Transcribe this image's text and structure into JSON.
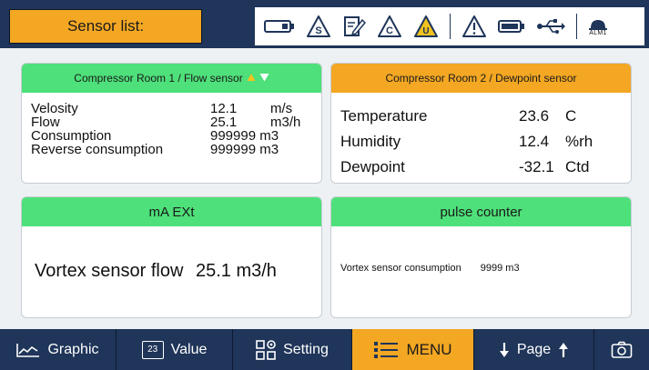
{
  "header": {
    "title": "Sensor list:",
    "status_icons": [
      "battery-icon",
      "service-s-icon",
      "edit-document-icon",
      "calibration-c-icon",
      "warning-u-icon",
      "warning-icon",
      "battery-full-icon",
      "usb-icon",
      "alarm-icon"
    ],
    "alarm_label": "ALM1"
  },
  "cards": {
    "flow": {
      "title": "Compressor Room 1 / Flow sensor",
      "rows": [
        {
          "label": "Velosity",
          "value": "12.1",
          "unit": "m/s"
        },
        {
          "label": "Flow",
          "value": "25.1",
          "unit": "m3/h"
        },
        {
          "label": "Consumption",
          "value": "999999 m3",
          "unit": ""
        },
        {
          "label": "Reverse consumption",
          "value": "999999 m3",
          "unit": ""
        }
      ]
    },
    "dewpoint": {
      "title": "Compressor Room 2 / Dewpoint sensor",
      "rows": [
        {
          "label": "Temperature",
          "value": "23.6",
          "unit": "C"
        },
        {
          "label": "Humidity",
          "value": "12.4",
          "unit": "%rh"
        },
        {
          "label": "Dewpoint",
          "value": "-32.1",
          "unit": "Ctd"
        }
      ]
    },
    "ma_ext": {
      "title": "mA EXt",
      "label": "Vortex sensor flow",
      "value": "25.1 m3/h"
    },
    "pulse": {
      "title": "pulse counter",
      "label": "Vortex sensor consumption",
      "value": "9999 m3"
    }
  },
  "footer": {
    "graphic": "Graphic",
    "value_icon_text": "23",
    "value": "Value",
    "setting": "Setting",
    "menu": "MENU",
    "page": "Page"
  },
  "colors": {
    "navy": "#1f3559",
    "orange": "#f3a723",
    "green": "#4ee07a"
  }
}
